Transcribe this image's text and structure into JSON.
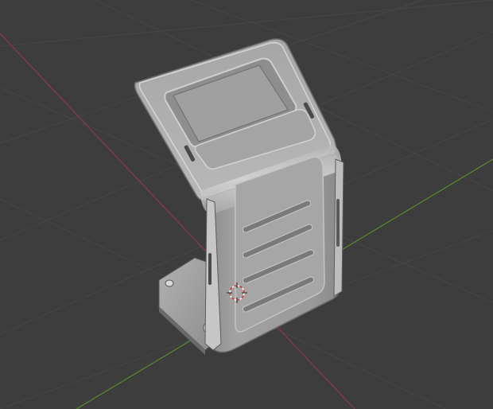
{
  "viewport": {
    "background_color": "#3d3d3d",
    "grid_line_color": "#474747",
    "x_axis_color": "#8a3a48",
    "y_axis_color": "#5c8a2c",
    "mesh_color": "#9a9a9a",
    "origin_icon": "3d-cursor-icon",
    "origin_icon_colors": [
      "#d23a3a",
      "#ffffff"
    ]
  }
}
